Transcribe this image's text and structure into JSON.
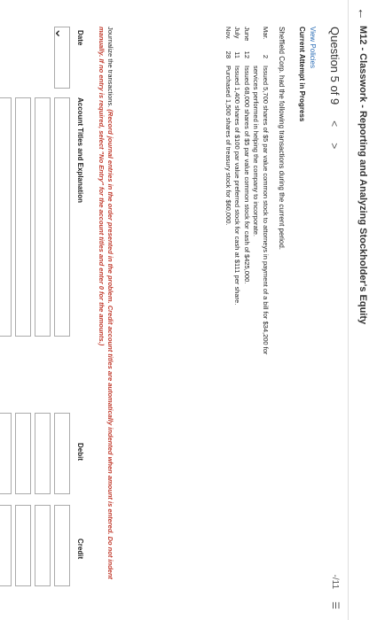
{
  "header": {
    "back_icon": "back-arrow-icon",
    "title": "M12 - Classwork - Reporting and Analyzing Stockholder's Equity"
  },
  "question": {
    "label": "Question 5 of 9",
    "prev": "<",
    "next": ">",
    "score": "-/11",
    "menu_icon": "list-icon"
  },
  "view_policies": "View Policies",
  "attempt": "Current Attempt in Progress",
  "intro": "Sheffield Corp. had the following transactions during the current period.",
  "transactions": [
    {
      "month": "Mar.",
      "day": "2",
      "text": "Issued 5,700 shares of $5 par value common stock to attorneys in payment of a bill for $34,200 for services performed in helping the company to incorporate."
    },
    {
      "month": "June",
      "day": "12",
      "text": "Issued 68,000 shares of $5 par value common stock for cash of $425,000."
    },
    {
      "month": "July",
      "day": "11",
      "text": "Issued 1,400 shares of $100 par value preferred stock for cash at $111 per share."
    },
    {
      "month": "Nov.",
      "day": "28",
      "text": "Purchased 1,500 shares of treasury stock for $60,000."
    }
  ],
  "instructions": {
    "lead": "Journalize the transactions.",
    "red": "(Record journal entries in the order presented in the problem. Credit account titles are automatically indented when amount is entered. Do not indent manually. If no entry is required, select \"No Entry\" for the account titles and enter 0 for the amounts.)"
  },
  "table": {
    "date": "Date",
    "account": "Account Titles and Explanation",
    "debit": "Debit",
    "credit": "Credit"
  }
}
